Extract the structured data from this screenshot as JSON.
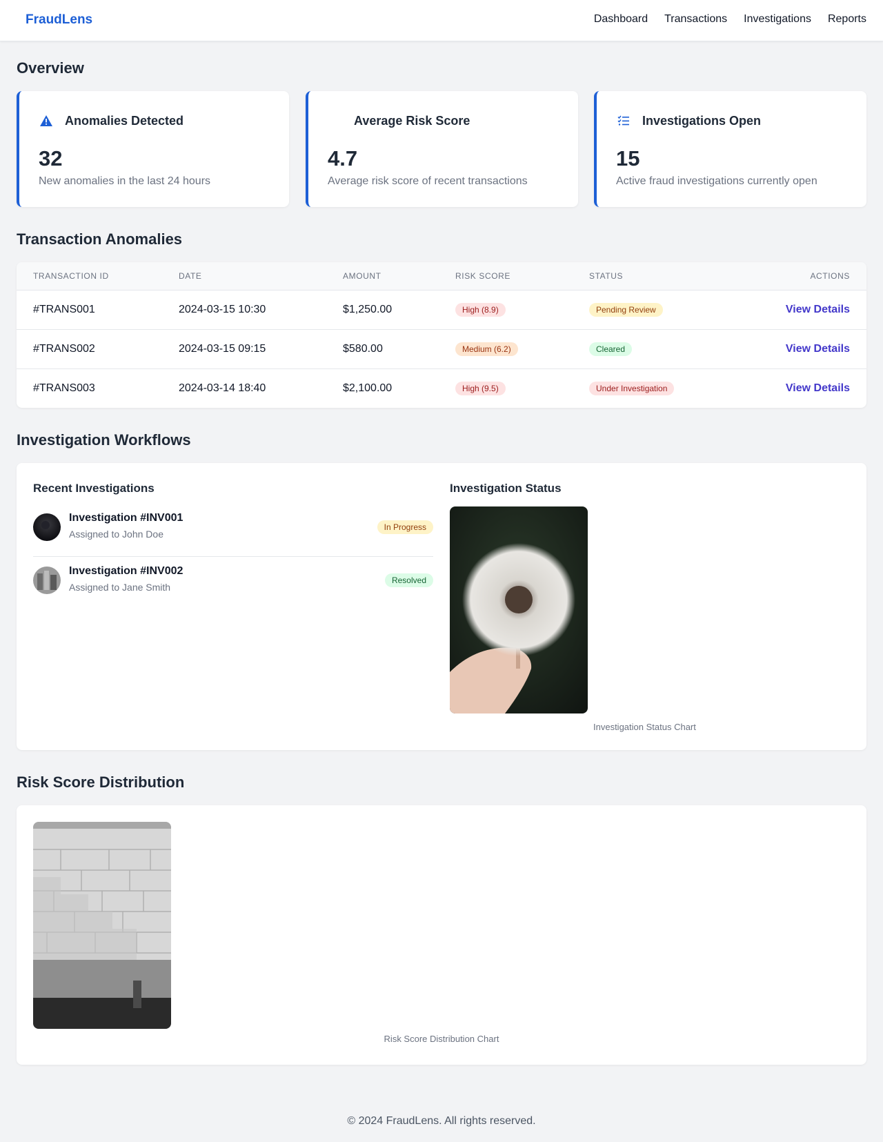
{
  "brand": "FraudLens",
  "nav": [
    "Dashboard",
    "Transactions",
    "Investigations",
    "Reports"
  ],
  "overview": {
    "title": "Overview",
    "cards": [
      {
        "icon": "warning-triangle-icon",
        "label": "Anomalies Detected",
        "value": "32",
        "desc": "New anomalies in the last 24 hours"
      },
      {
        "icon": "",
        "label": "Average Risk Score",
        "value": "4.7",
        "desc": "Average risk score of recent transactions"
      },
      {
        "icon": "checklist-icon",
        "label": "Investigations Open",
        "value": "15",
        "desc": "Active fraud investigations currently open"
      }
    ]
  },
  "anomalies": {
    "title": "Transaction Anomalies",
    "columns": [
      "TRANSACTION ID",
      "DATE",
      "AMOUNT",
      "RISK SCORE",
      "STATUS",
      "ACTIONS"
    ],
    "rows": [
      {
        "id": "#TRANS001",
        "date": "2024-03-15 10:30",
        "amount": "$1,250.00",
        "risk": "High (8.9)",
        "risk_color": "#fde2e2",
        "status": "Pending Review",
        "status_color": "#fef3c7",
        "action": "View Details"
      },
      {
        "id": "#TRANS002",
        "date": "2024-03-15 09:15",
        "amount": "$580.00",
        "risk": "Medium (6.2)",
        "risk_color": "#fde5cf",
        "status": "Cleared",
        "status_color": "#dcfce7",
        "action": "View Details"
      },
      {
        "id": "#TRANS003",
        "date": "2024-03-14 18:40",
        "amount": "$2,100.00",
        "risk": "High (9.5)",
        "risk_color": "#fde2e2",
        "status": "Under Investigation",
        "status_color": "#fde2e2",
        "action": "View Details"
      }
    ]
  },
  "workflows": {
    "title": "Investigation Workflows",
    "recent_title": "Recent Investigations",
    "items": [
      {
        "title": "Investigation #INV001",
        "assigned": "Assigned to John Doe",
        "status": "In Progress",
        "status_color": "#fef3c7"
      },
      {
        "title": "Investigation #INV002",
        "assigned": "Assigned to Jane Smith",
        "status": "Resolved",
        "status_color": "#dcfce7"
      }
    ],
    "status_title": "Investigation Status",
    "status_caption": "Investigation Status Chart"
  },
  "risk": {
    "title": "Risk Score Distribution",
    "caption": "Risk Score Distribution Chart"
  },
  "footer": "© 2024 FraudLens. All rights reserved.",
  "colors": {
    "brand": "#1d5fd6",
    "link": "#4338ca",
    "background": "#f2f3f5"
  }
}
